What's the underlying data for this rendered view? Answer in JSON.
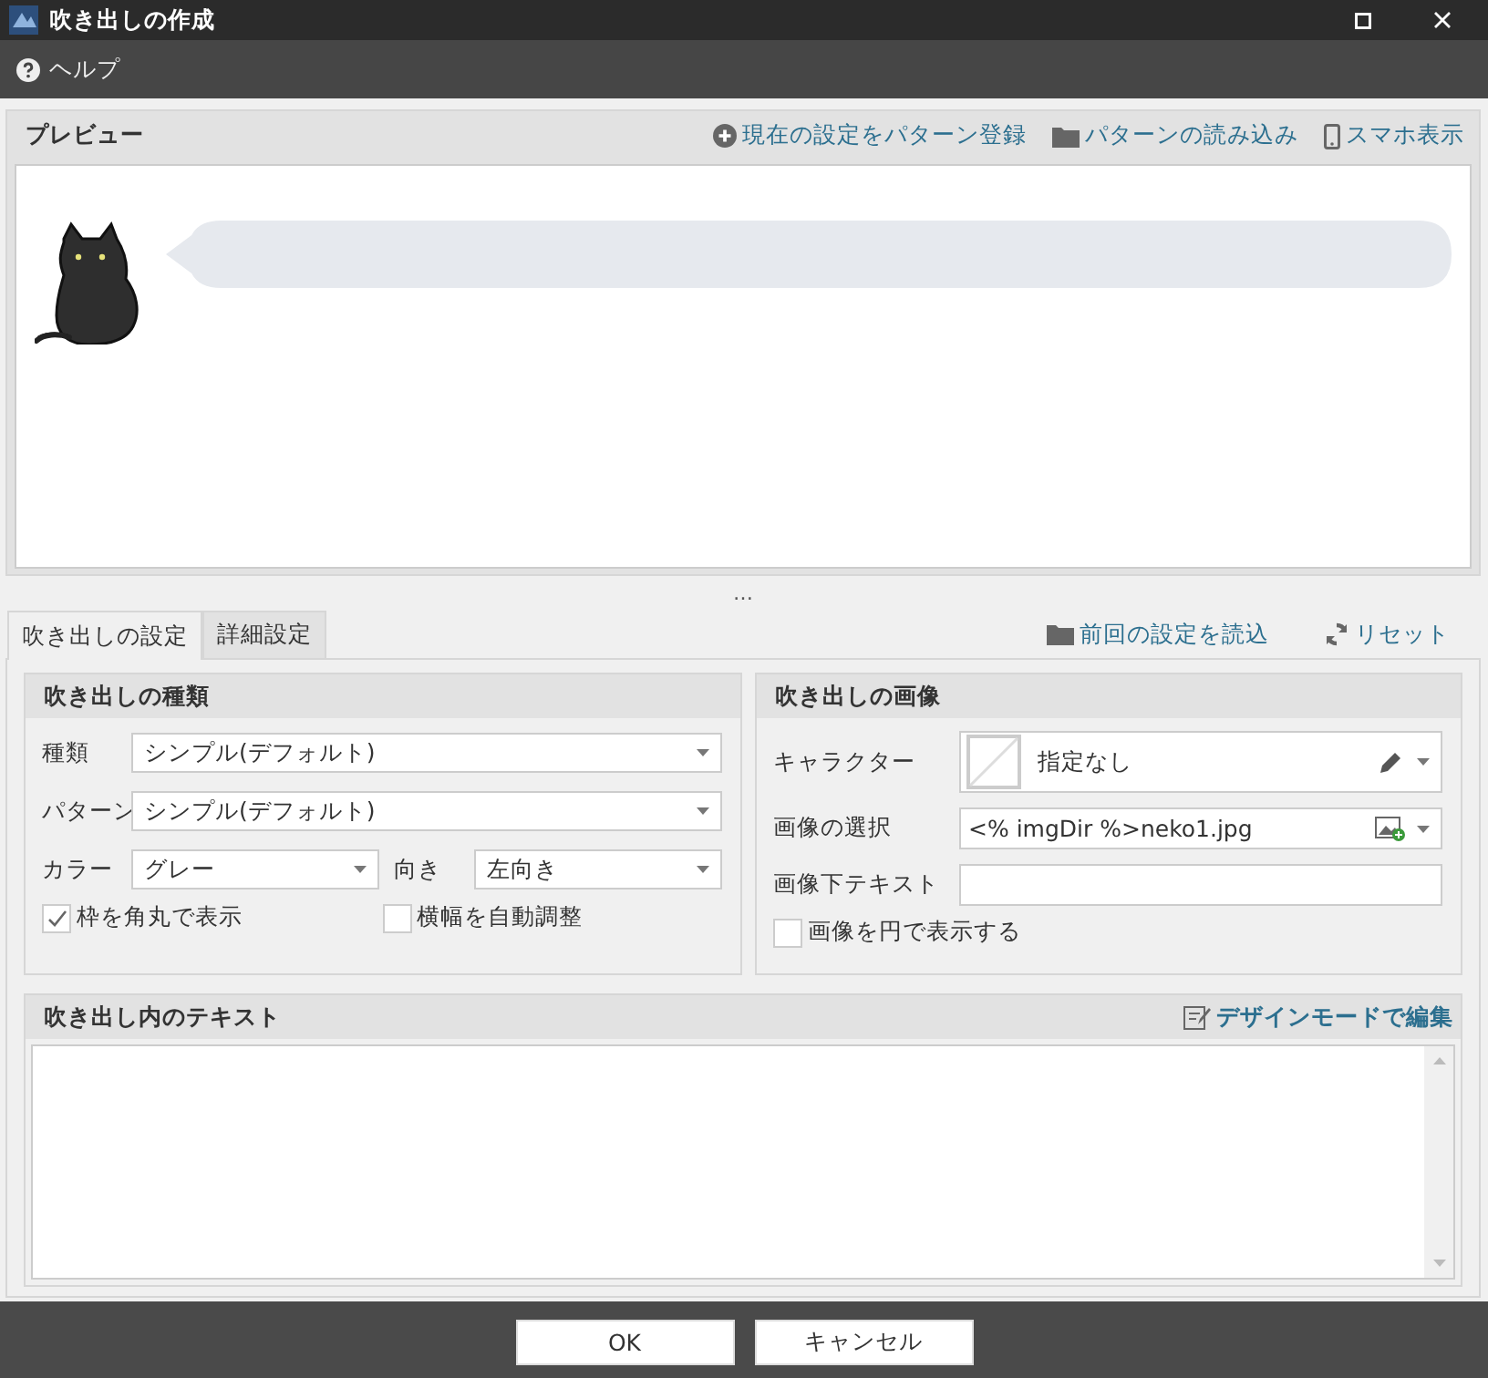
{
  "window": {
    "title": "吹き出しの作成"
  },
  "menu": [
    {
      "label": "ヘルプ",
      "kind": "help"
    }
  ],
  "preview": {
    "title": "プレビュー",
    "actions": [
      {
        "label": "現在の設定をパターン登録",
        "kind": "add"
      },
      {
        "label": "パターンの読み込み",
        "kind": "folder"
      },
      {
        "label": "スマホ表示",
        "kind": "phone"
      }
    ]
  },
  "splitter": "…",
  "tabs": [
    {
      "label": "吹き出しの設定",
      "selected": true
    },
    {
      "label": "詳細設定",
      "selected": false
    }
  ],
  "tab_actions": [
    {
      "label": "前回の設定を読込",
      "kind": "folder"
    },
    {
      "label": "リセット",
      "kind": "reset"
    }
  ],
  "balloon_type": {
    "title": "吹き出しの種類",
    "rows": [
      [
        {
          "label": "種類",
          "value": "シンプル(デフォルト)"
        }
      ],
      [
        {
          "label": "パターン",
          "value": "シンプル(デフォルト)"
        }
      ],
      [
        {
          "label": "カラー",
          "value": "グレー"
        },
        {
          "label": "向き",
          "value": "左向き"
        }
      ]
    ],
    "checks": [
      {
        "label": "枠を角丸で表示",
        "checked": true
      },
      {
        "label": "横幅を自動調整",
        "checked": false
      }
    ]
  },
  "balloon_image": {
    "title": "吹き出しの画像",
    "fields": [
      {
        "kind": "character",
        "label": "キャラクター",
        "value": "指定なし"
      },
      {
        "kind": "image",
        "label": "画像の選択",
        "value": "<% imgDir %>neko1.jpg"
      },
      {
        "kind": "text",
        "label": "画像下テキスト"
      }
    ],
    "checks": [
      {
        "label": "画像を円で表示する",
        "checked": false
      }
    ]
  },
  "balloon_text": {
    "title": "吹き出し内のテキスト",
    "action": "デザインモードで編集"
  },
  "buttons": [
    "OK",
    "キャンセル"
  ]
}
